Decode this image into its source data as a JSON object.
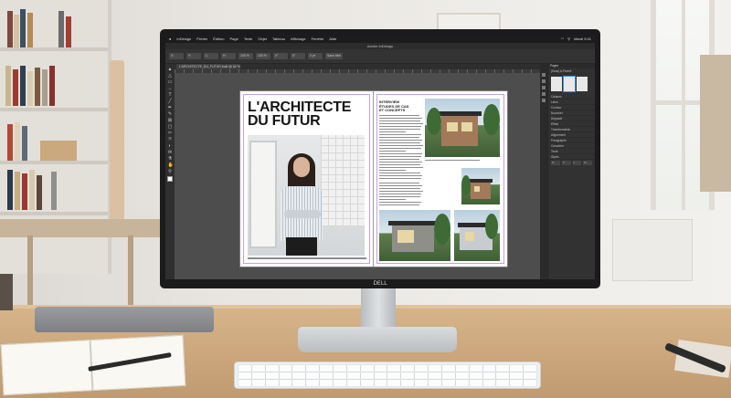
{
  "app": {
    "menu": [
      "InDesign",
      "Fichier",
      "Édition",
      "Page",
      "Texte",
      "Objet",
      "Tableau",
      "Affichage",
      "Fenêtre",
      "Aide"
    ],
    "status_right": "Mardi 9:41",
    "document_title": "Adobe InDesign",
    "tab_label": "L'ARCHITECTE_DU_FUTUR.indd @ 62 %"
  },
  "control_bar": {
    "fields": [
      "X:",
      "Y:",
      "L:",
      "H:",
      "100 %",
      "100 %",
      "0°",
      "0°",
      "0 pt",
      "Sans titre"
    ]
  },
  "toolbar": {
    "tools": [
      "selection-tool",
      "direct-selection-tool",
      "page-tool",
      "gap-tool",
      "type-tool",
      "line-tool",
      "pen-tool",
      "pencil-tool",
      "rectangle-frame-tool",
      "rectangle-tool",
      "scissors-tool",
      "free-transform-tool",
      "gradient-tool",
      "note-tool",
      "eyedropper-tool",
      "hand-tool",
      "zoom-tool"
    ]
  },
  "spread": {
    "headline": "L'ARCHITECTE\nDU FUTUR",
    "right_heading": "INTERVIEW\nÉTUDES DE CAS\nET CONCEPTS"
  },
  "panels": {
    "pages_title": "Pages",
    "master_label": "[Sans] A-Parent",
    "rows": [
      "Calques",
      "Liens",
      "Contour",
      "Nuancier",
      "Dégradé",
      "Effets",
      "Transformation",
      "Alignement",
      "Paragraphe",
      "Caractère",
      "Texte",
      "Styles"
    ],
    "fields": [
      "X",
      "Y",
      "L",
      "H"
    ]
  },
  "hardware": {
    "monitor_brand": "DELL"
  },
  "colors": {
    "accent": "#3c8cff",
    "app_bg": "#3b3b3b",
    "desk": "#caa47a"
  }
}
